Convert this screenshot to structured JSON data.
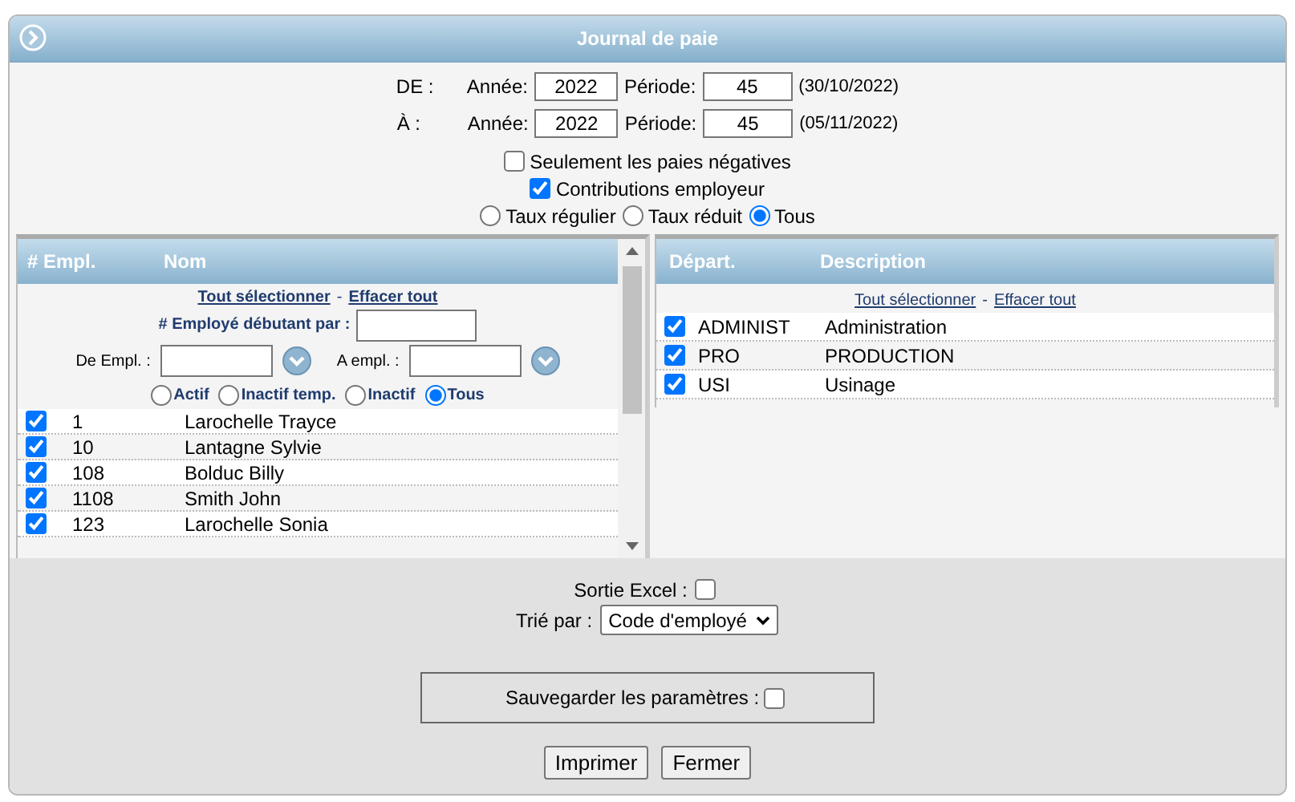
{
  "window": {
    "title": "Journal de paie"
  },
  "periods": [
    {
      "label": "DE :",
      "year_label": "Année:",
      "year": "2022",
      "period_label": "Période:",
      "period": "45",
      "date": "(30/10/2022)"
    },
    {
      "label": "À :",
      "year_label": "Année:",
      "year": "2022",
      "period_label": "Période:",
      "period": "45",
      "date": "(05/11/2022)"
    }
  ],
  "options": [
    {
      "label": "Seulement les paies négatives",
      "checked": false
    },
    {
      "label": "Contributions employeur",
      "checked": true
    }
  ],
  "rate": [
    {
      "label": "Taux régulier",
      "selected": false
    },
    {
      "label": "Taux réduit",
      "selected": false
    },
    {
      "label": "Tous",
      "selected": true
    }
  ],
  "employees": {
    "columns": [
      "# Empl.",
      "Nom"
    ],
    "select_all": "Tout sélectionner",
    "separator": "-",
    "clear_all": "Effacer tout",
    "starting_label": "# Employé débutant par :",
    "from_label": "De Empl. :",
    "to_label": "A empl. :",
    "status": [
      {
        "label": "Actif",
        "selected": false
      },
      {
        "label": "Inactif temp.",
        "selected": false
      },
      {
        "label": "Inactif",
        "selected": false
      },
      {
        "label": "Tous",
        "selected": true
      }
    ],
    "rows": [
      {
        "id": "1",
        "name": "Larochelle Trayce",
        "checked": true
      },
      {
        "id": "10",
        "name": "Lantagne Sylvie",
        "checked": true
      },
      {
        "id": "108",
        "name": "Bolduc Billy",
        "checked": true
      },
      {
        "id": "1108",
        "name": "Smith John",
        "checked": true
      },
      {
        "id": "123",
        "name": "Larochelle Sonia",
        "checked": true
      }
    ]
  },
  "departments": {
    "columns": [
      "Départ.",
      "Description"
    ],
    "select_all": "Tout sélectionner",
    "separator": "-",
    "clear_all": "Effacer tout",
    "rows": [
      {
        "code": "ADMINIST",
        "description": "Administration",
        "checked": true
      },
      {
        "code": "PRO",
        "description": "PRODUCTION",
        "checked": true
      },
      {
        "code": "USI",
        "description": "Usinage",
        "checked": true
      }
    ]
  },
  "excel": {
    "label": "Sortie Excel :",
    "checked": false
  },
  "sort": {
    "label": "Trié par :",
    "value": "Code d'employé"
  },
  "save": {
    "label": "Sauvegarder les paramètres :",
    "checked": false
  },
  "buttons": [
    "Imprimer",
    "Fermer"
  ]
}
